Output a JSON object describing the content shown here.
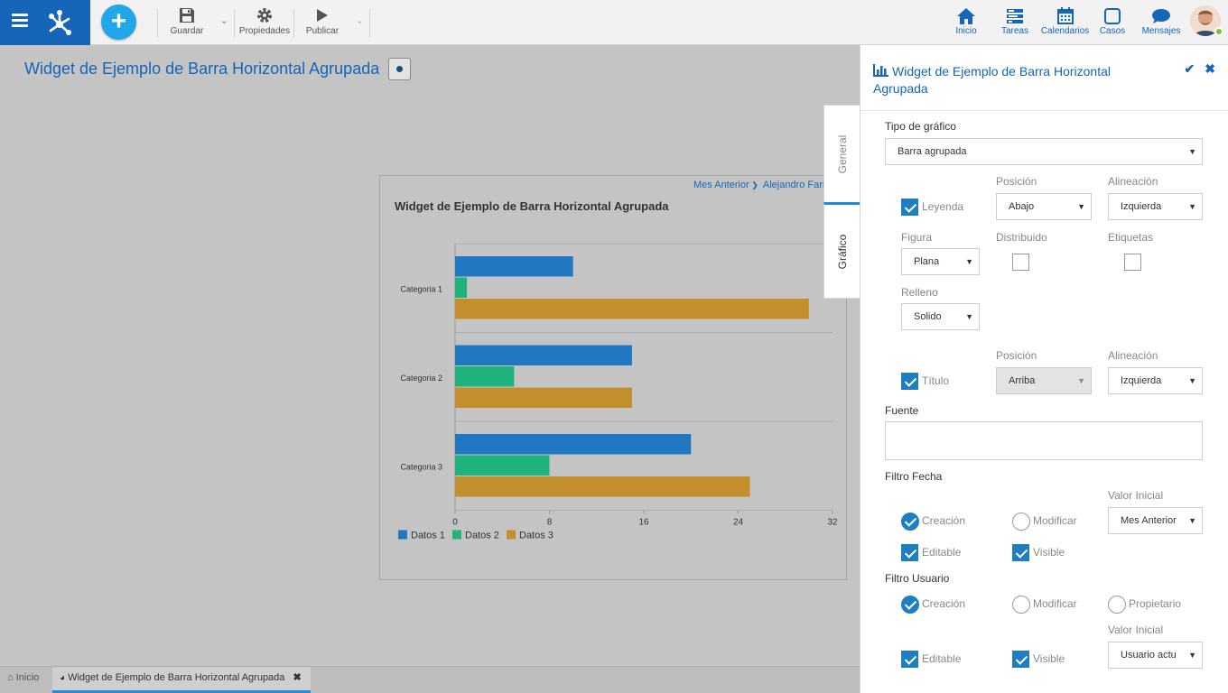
{
  "toolbar": {
    "save_label": "Guardar",
    "properties_label": "Propiedades",
    "publish_label": "Publicar",
    "add_icon": "plus-icon",
    "save_icon": "floppy-icon",
    "properties_icon": "gear-icon",
    "publish_icon": "play-icon"
  },
  "nav": {
    "home": "Inicio",
    "tasks": "Tareas",
    "calendars": "Calendarios",
    "cases": "Casos",
    "messages": "Mensajes"
  },
  "colors": {
    "brand": "#1565b8",
    "accent": "#1fa7e8",
    "series1": "#1f78c1",
    "series2": "#1fb27b",
    "series3": "#c38f2c"
  },
  "page": {
    "title": "Widget de Ejemplo de Barra Horizontal Agrupada"
  },
  "widget": {
    "filter_date": "Mes Anterior",
    "filter_user": "Alejandro Fari",
    "title": "Widget de Ejemplo de Barra Horizontal Agrupada"
  },
  "chart_data": {
    "type": "bar",
    "orientation": "horizontal",
    "title": "Widget de Ejemplo de Barra Horizontal Agrupada",
    "categories": [
      "Categoria 1",
      "Categoria 2",
      "Categoria 3"
    ],
    "series": [
      {
        "name": "Datos 1",
        "values": [
          10,
          15,
          20
        ]
      },
      {
        "name": "Datos 2",
        "values": [
          1,
          5,
          8
        ]
      },
      {
        "name": "Datos 3",
        "values": [
          30,
          15,
          25
        ]
      }
    ],
    "xlim": [
      0,
      32
    ],
    "xticks": [
      "0",
      "8",
      "16",
      "24",
      "32"
    ],
    "legend": "bottom-left",
    "grid": false
  },
  "bottom_tabs": {
    "home": "Inicio",
    "widget": "Widget de Ejemplo de Barra Horizontal Agrupada"
  },
  "panel": {
    "title": "Widget de Ejemplo de Barra Horizontal Agrupada",
    "tab_general": "General",
    "tab_chart": "Gráfico",
    "chart_type_label": "Tipo de gráfico",
    "chart_type_value": "Barra agrupada",
    "position_label": "Posición",
    "alignment_label": "Alineación",
    "legend_label": "Leyenda",
    "legend_checked": true,
    "legend_position": "Abajo",
    "legend_alignment": "Izquierda",
    "figure_label": "Figura",
    "figure_value": "Plana",
    "distributed_label": "Distribuido",
    "distributed_checked": false,
    "labels_label": "Etiquetas",
    "labels_checked": false,
    "fill_label": "Relleno",
    "fill_value": "Solido",
    "title_position_label": "Posición",
    "title_alignment_label": "Alineación",
    "title_label": "Título",
    "title_checked": true,
    "title_position": "Arriba",
    "title_alignment": "Izquierda",
    "source_label": "Fuente",
    "source_value": "",
    "date_filter_label": "Filtro Fecha",
    "date_initial_label": "Valor Inicial",
    "date_creation": "Creación",
    "date_modify": "Modificar",
    "date_initial_value": "Mes Anterior",
    "date_editable": "Editable",
    "date_visible": "Visible",
    "user_filter_label": "Filtro Usuario",
    "user_creation": "Creación",
    "user_modify": "Modificar",
    "user_owner": "Propietario",
    "user_initial_label": "Valor Inicial",
    "user_initial_value": "Usuario actu",
    "user_editable": "Editable",
    "user_visible": "Visible"
  }
}
